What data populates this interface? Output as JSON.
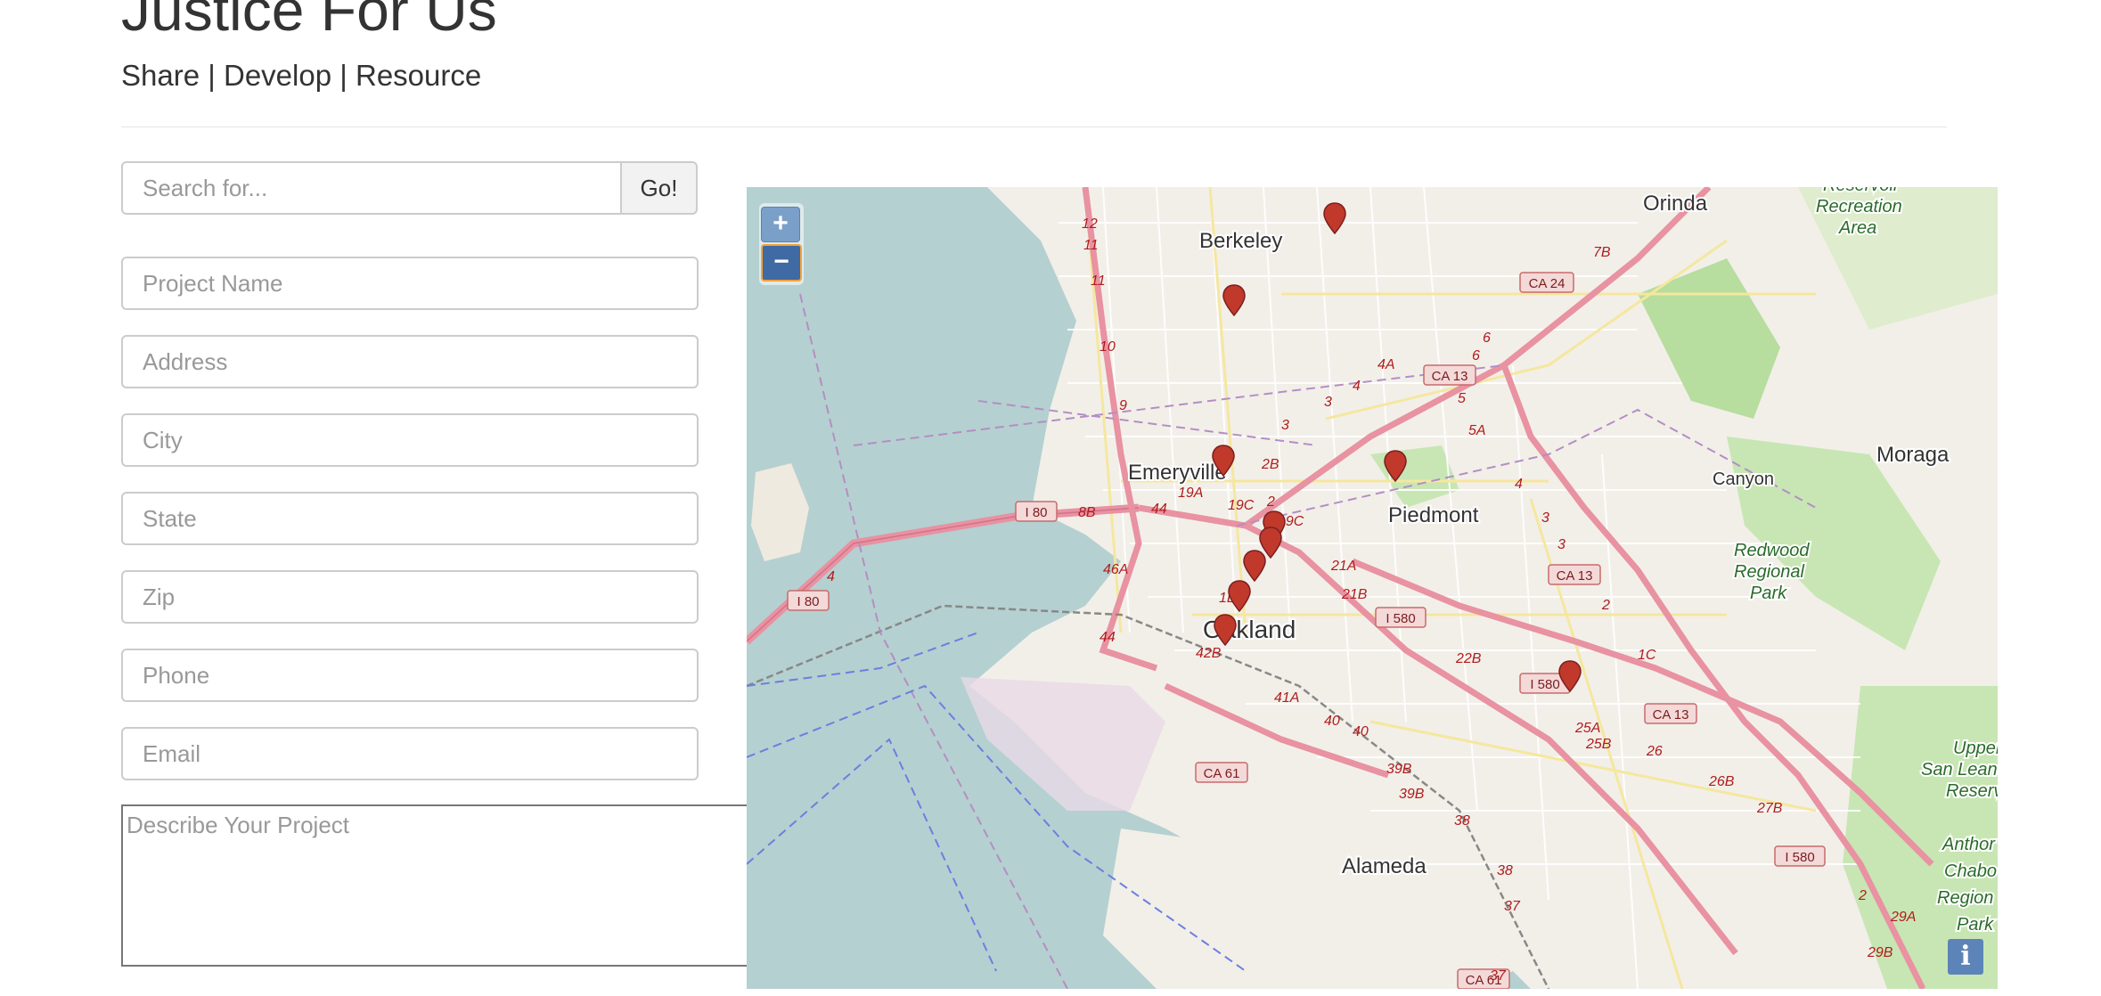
{
  "header": {
    "title": "Justice For Us",
    "nav": {
      "share": "Share",
      "develop": "Develop",
      "resource": "Resource",
      "separator": "|"
    }
  },
  "search": {
    "placeholder": "Search for...",
    "button_label": "Go!"
  },
  "form": {
    "project_name_placeholder": "Project Name",
    "address_placeholder": "Address",
    "city_placeholder": "City",
    "state_placeholder": "State",
    "zip_placeholder": "Zip",
    "phone_placeholder": "Phone",
    "email_placeholder": "Email",
    "description_placeholder": "Describe Your Project"
  },
  "map": {
    "zoom_in_label": "+",
    "zoom_out_label": "−",
    "info_label": "i",
    "place_labels": {
      "berkeley": "Berkeley",
      "orinda": "Orinda",
      "emeryville": "Emeryville",
      "piedmont": "Piedmont",
      "oakland": "Oakland",
      "alameda": "Alameda",
      "moraga": "Moraga",
      "canyon": "Canyon",
      "reservoir": "Reservoir",
      "recreation": "Recreation",
      "area": "Area",
      "redwood": "Redwood",
      "regional": "Regional",
      "park": "Park",
      "upper": "Upper",
      "san_leandro": "San Leand",
      "reservoir2": "Reserv",
      "anthony": "Anthor",
      "chabot": "Chabo",
      "region": "Region",
      "park2": "Park"
    },
    "road_shields": {
      "ca24": "CA 24",
      "ca13a": "CA 13",
      "ca13b": "CA 13",
      "ca13c": "CA 13",
      "i80a": "I 80",
      "i80b": "I 80",
      "i580a": "I 580",
      "i580b": "I 580",
      "i580c": "I 580",
      "ca61a": "CA 61",
      "ca61b": "CA 61"
    },
    "exit_labels": [
      "12",
      "11",
      "11",
      "10",
      "9",
      "7B",
      "6",
      "6",
      "4A",
      "4",
      "3",
      "3",
      "5",
      "5A",
      "4",
      "3",
      "3",
      "2",
      "2B",
      "2",
      "19C",
      "19A",
      "19C",
      "8B",
      "44",
      "46A",
      "4",
      "21A",
      "21B",
      "1C",
      "1D",
      "42B",
      "44",
      "41A",
      "40",
      "40",
      "22B",
      "25A",
      "25B",
      "26",
      "26B",
      "27B",
      "2",
      "39B",
      "39B",
      "38",
      "38",
      "37",
      "37",
      "29A",
      "29B"
    ],
    "marker_count": 10,
    "colors": {
      "water": "#b5d0d0",
      "land": "#f2efe9",
      "park": "#c8e6b4",
      "motorway": "#e892a2",
      "marker": "#c0392b"
    }
  }
}
